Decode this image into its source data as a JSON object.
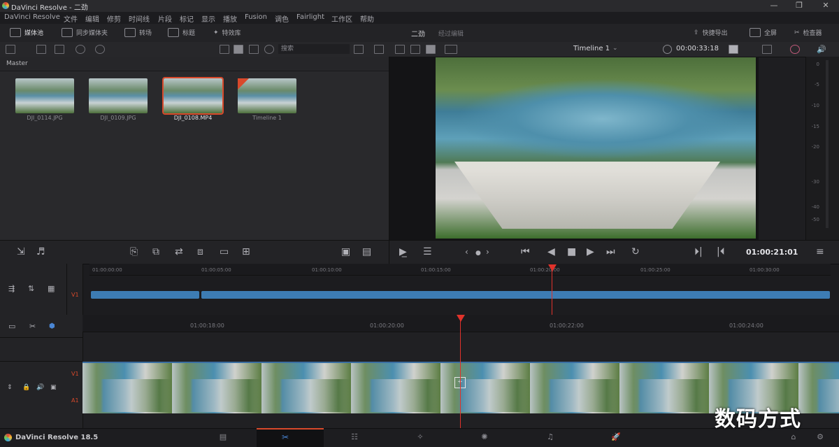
{
  "window": {
    "title": "DaVinci Resolve - 二劲"
  },
  "menu": [
    "DaVinci Resolve",
    "文件",
    "编辑",
    "修剪",
    "时间线",
    "片段",
    "标记",
    "显示",
    "播放",
    "Fusion",
    "调色",
    "Fairlight",
    "工作区",
    "帮助"
  ],
  "toolbar": {
    "media_pool": "媒体池",
    "sync_bin": "同步媒体夹",
    "transitions": "转场",
    "titles": "标题",
    "effects": "特效库",
    "project_name": "二劲",
    "status": "经过编辑",
    "quick_export": "快捷导出",
    "fullscreen": "全屏",
    "inspector": "检查器"
  },
  "pool": {
    "search_placeholder": "搜索",
    "bin": "Master",
    "clips": [
      {
        "name": "DJI_0114.JPG"
      },
      {
        "name": "DJI_0109.JPG"
      },
      {
        "name": "DJI_0108.MP4"
      },
      {
        "name": "Timeline 1"
      }
    ]
  },
  "viewer": {
    "timeline_name": "Timeline 1",
    "duration": "00:00:33:18",
    "timecode": "01:00:21:01"
  },
  "meter": {
    "ticks": [
      "0",
      "-5",
      "-10",
      "-15",
      "-20",
      "-30",
      "-40",
      "-50"
    ]
  },
  "upper_ruler": [
    "01:00:00:00",
    "01:00:05:00",
    "01:00:10:00",
    "01:00:15:00",
    "01:00:20:00",
    "01:00:25:00",
    "01:00:30:00"
  ],
  "lower_ruler": [
    "01:00:18:00",
    "01:00:20:00",
    "01:00:22:00",
    "01:00:24:00"
  ],
  "tracks": {
    "upper_video": "V1",
    "lower_video": "V1",
    "lower_audio": "A1"
  },
  "footer": {
    "brand": "DaVinci Resolve 18.5"
  },
  "watermark": "数码方式",
  "colors": {
    "accent": "#d9492b",
    "clip_blue": "#3d7cb3",
    "playhead": "#e0322b"
  }
}
